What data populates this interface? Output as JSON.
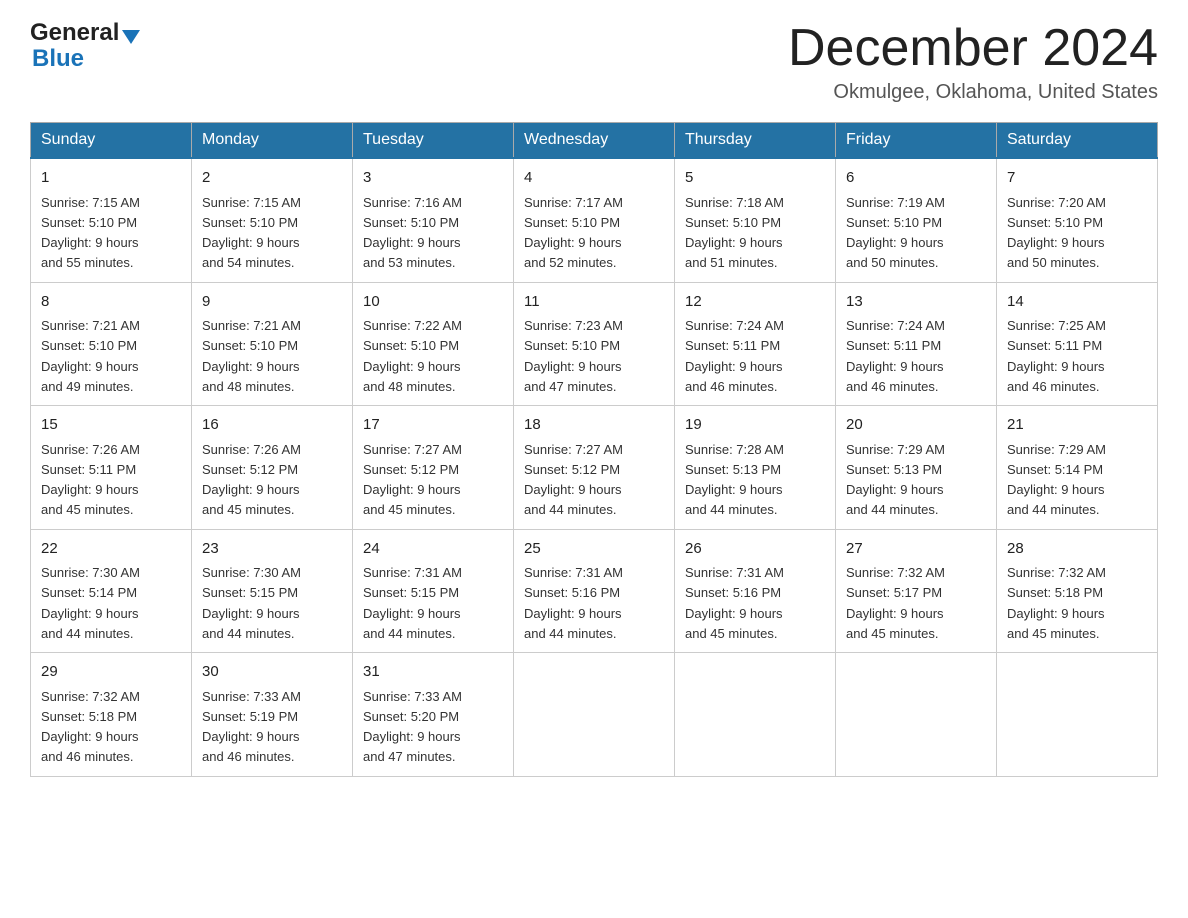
{
  "header": {
    "title": "December 2024",
    "location": "Okmulgee, Oklahoma, United States",
    "logo_general": "General",
    "logo_blue": "Blue"
  },
  "calendar": {
    "days_of_week": [
      "Sunday",
      "Monday",
      "Tuesday",
      "Wednesday",
      "Thursday",
      "Friday",
      "Saturday"
    ],
    "weeks": [
      [
        {
          "day": "1",
          "sunrise": "7:15 AM",
          "sunset": "5:10 PM",
          "daylight": "9 hours and 55 minutes."
        },
        {
          "day": "2",
          "sunrise": "7:15 AM",
          "sunset": "5:10 PM",
          "daylight": "9 hours and 54 minutes."
        },
        {
          "day": "3",
          "sunrise": "7:16 AM",
          "sunset": "5:10 PM",
          "daylight": "9 hours and 53 minutes."
        },
        {
          "day": "4",
          "sunrise": "7:17 AM",
          "sunset": "5:10 PM",
          "daylight": "9 hours and 52 minutes."
        },
        {
          "day": "5",
          "sunrise": "7:18 AM",
          "sunset": "5:10 PM",
          "daylight": "9 hours and 51 minutes."
        },
        {
          "day": "6",
          "sunrise": "7:19 AM",
          "sunset": "5:10 PM",
          "daylight": "9 hours and 50 minutes."
        },
        {
          "day": "7",
          "sunrise": "7:20 AM",
          "sunset": "5:10 PM",
          "daylight": "9 hours and 50 minutes."
        }
      ],
      [
        {
          "day": "8",
          "sunrise": "7:21 AM",
          "sunset": "5:10 PM",
          "daylight": "9 hours and 49 minutes."
        },
        {
          "day": "9",
          "sunrise": "7:21 AM",
          "sunset": "5:10 PM",
          "daylight": "9 hours and 48 minutes."
        },
        {
          "day": "10",
          "sunrise": "7:22 AM",
          "sunset": "5:10 PM",
          "daylight": "9 hours and 48 minutes."
        },
        {
          "day": "11",
          "sunrise": "7:23 AM",
          "sunset": "5:10 PM",
          "daylight": "9 hours and 47 minutes."
        },
        {
          "day": "12",
          "sunrise": "7:24 AM",
          "sunset": "5:11 PM",
          "daylight": "9 hours and 46 minutes."
        },
        {
          "day": "13",
          "sunrise": "7:24 AM",
          "sunset": "5:11 PM",
          "daylight": "9 hours and 46 minutes."
        },
        {
          "day": "14",
          "sunrise": "7:25 AM",
          "sunset": "5:11 PM",
          "daylight": "9 hours and 46 minutes."
        }
      ],
      [
        {
          "day": "15",
          "sunrise": "7:26 AM",
          "sunset": "5:11 PM",
          "daylight": "9 hours and 45 minutes."
        },
        {
          "day": "16",
          "sunrise": "7:26 AM",
          "sunset": "5:12 PM",
          "daylight": "9 hours and 45 minutes."
        },
        {
          "day": "17",
          "sunrise": "7:27 AM",
          "sunset": "5:12 PM",
          "daylight": "9 hours and 45 minutes."
        },
        {
          "day": "18",
          "sunrise": "7:27 AM",
          "sunset": "5:12 PM",
          "daylight": "9 hours and 44 minutes."
        },
        {
          "day": "19",
          "sunrise": "7:28 AM",
          "sunset": "5:13 PM",
          "daylight": "9 hours and 44 minutes."
        },
        {
          "day": "20",
          "sunrise": "7:29 AM",
          "sunset": "5:13 PM",
          "daylight": "9 hours and 44 minutes."
        },
        {
          "day": "21",
          "sunrise": "7:29 AM",
          "sunset": "5:14 PM",
          "daylight": "9 hours and 44 minutes."
        }
      ],
      [
        {
          "day": "22",
          "sunrise": "7:30 AM",
          "sunset": "5:14 PM",
          "daylight": "9 hours and 44 minutes."
        },
        {
          "day": "23",
          "sunrise": "7:30 AM",
          "sunset": "5:15 PM",
          "daylight": "9 hours and 44 minutes."
        },
        {
          "day": "24",
          "sunrise": "7:31 AM",
          "sunset": "5:15 PM",
          "daylight": "9 hours and 44 minutes."
        },
        {
          "day": "25",
          "sunrise": "7:31 AM",
          "sunset": "5:16 PM",
          "daylight": "9 hours and 44 minutes."
        },
        {
          "day": "26",
          "sunrise": "7:31 AM",
          "sunset": "5:16 PM",
          "daylight": "9 hours and 45 minutes."
        },
        {
          "day": "27",
          "sunrise": "7:32 AM",
          "sunset": "5:17 PM",
          "daylight": "9 hours and 45 minutes."
        },
        {
          "day": "28",
          "sunrise": "7:32 AM",
          "sunset": "5:18 PM",
          "daylight": "9 hours and 45 minutes."
        }
      ],
      [
        {
          "day": "29",
          "sunrise": "7:32 AM",
          "sunset": "5:18 PM",
          "daylight": "9 hours and 46 minutes."
        },
        {
          "day": "30",
          "sunrise": "7:33 AM",
          "sunset": "5:19 PM",
          "daylight": "9 hours and 46 minutes."
        },
        {
          "day": "31",
          "sunrise": "7:33 AM",
          "sunset": "5:20 PM",
          "daylight": "9 hours and 47 minutes."
        },
        null,
        null,
        null,
        null
      ]
    ],
    "labels": {
      "sunrise": "Sunrise:",
      "sunset": "Sunset:",
      "daylight": "Daylight:"
    }
  }
}
